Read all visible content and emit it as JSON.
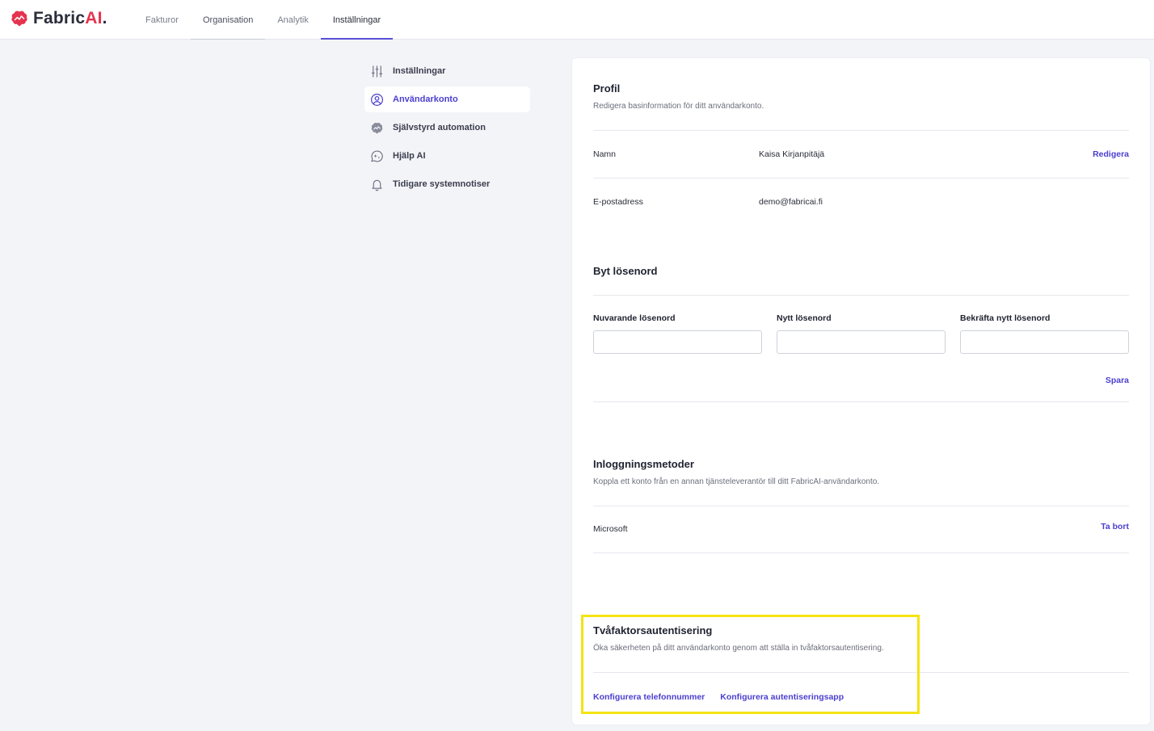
{
  "brand": {
    "name_main": "Fabric",
    "name_accent": "AI",
    "name_dot": ".",
    "accent_color": "#e4344f"
  },
  "nav": {
    "items": [
      {
        "label": "Fakturor"
      },
      {
        "label": "Organisation"
      },
      {
        "label": "Analytik"
      },
      {
        "label": "Inställningar"
      }
    ],
    "active": "Inställningar"
  },
  "sidebar": {
    "items": [
      {
        "label": "Inställningar",
        "icon": "sliders-icon"
      },
      {
        "label": "Användarkonto",
        "icon": "user-circle-icon"
      },
      {
        "label": "Självstyrd automation",
        "icon": "brain-icon"
      },
      {
        "label": "Hjälp AI",
        "icon": "ai-chat-icon"
      },
      {
        "label": "Tidigare systemnotiser",
        "icon": "bell-icon"
      }
    ],
    "active": "Användarkonto"
  },
  "profile": {
    "title": "Profil",
    "subtitle": "Redigera basinformation för ditt användarkonto.",
    "name_label": "Namn",
    "name_value": "Kaisa Kirjanpitäjä",
    "edit_label": "Redigera",
    "email_label": "E-postadress",
    "email_value": "demo@fabricai.fi"
  },
  "password": {
    "title": "Byt lösenord",
    "current_label": "Nuvarande lösenord",
    "new_label": "Nytt lösenord",
    "confirm_label": "Bekräfta nytt lösenord",
    "save_label": "Spara"
  },
  "login_methods": {
    "title": "Inloggningsmetoder",
    "subtitle": "Koppla ett konto från en annan tjänsteleverantör till ditt FabricAI-användarkonto.",
    "provider": "Microsoft",
    "remove_label": "Ta bort"
  },
  "two_factor": {
    "title": "Tvåfaktorsautentisering",
    "subtitle": "Öka säkerheten på ditt användarkonto genom att ställa in tvåfaktorsautentisering.",
    "phone_link": "Konfigurera telefonnummer",
    "app_link": "Konfigurera autentiseringsapp"
  },
  "colors": {
    "primary": "#4b3fcf",
    "highlight": "#f5e312",
    "background": "#f3f4f8"
  }
}
